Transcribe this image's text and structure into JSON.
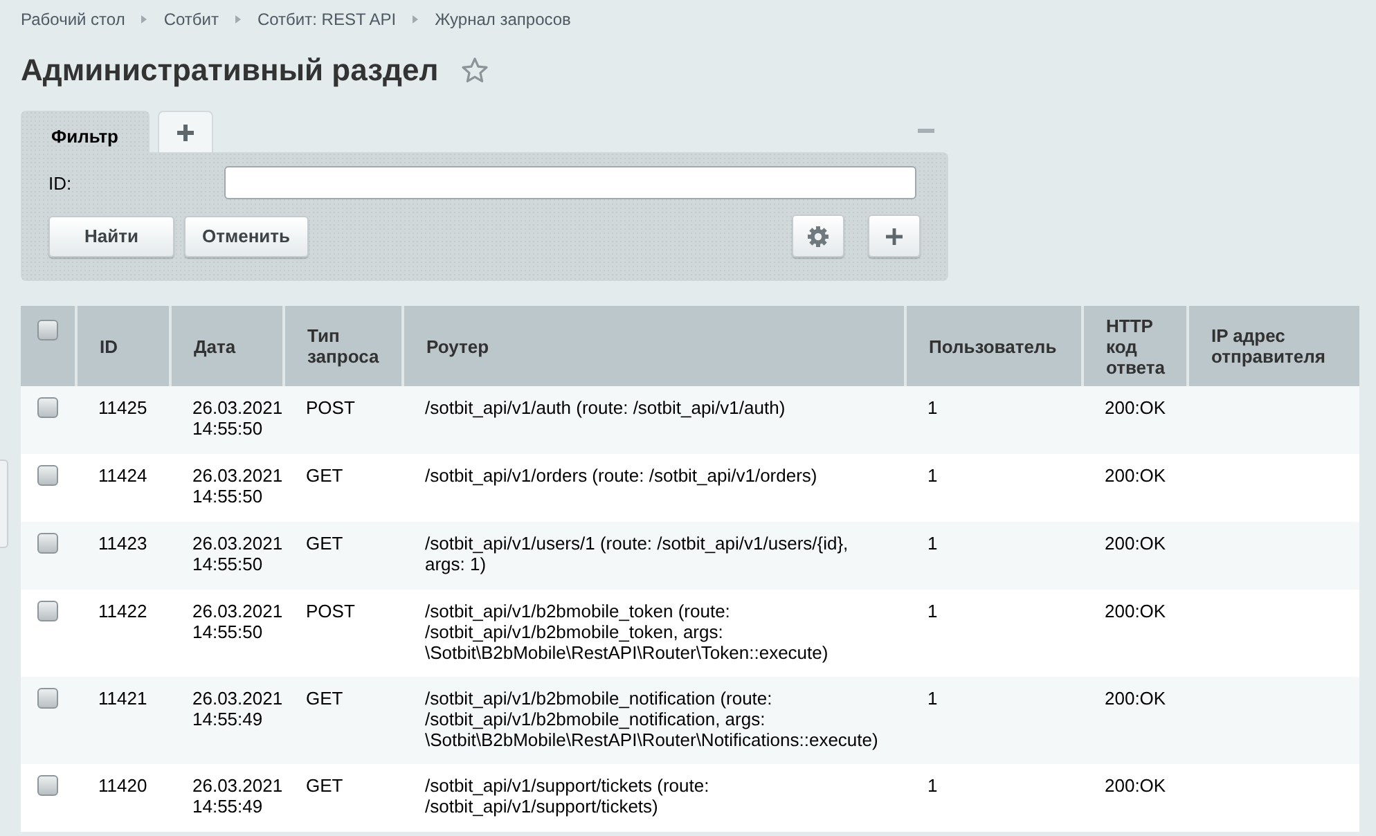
{
  "breadcrumbs": [
    "Рабочий стол",
    "Сотбит",
    "Сотбит: REST API",
    "Журнал запросов"
  ],
  "page_title": "Административный раздел",
  "filter": {
    "tabs": [
      {
        "label": "Фильтр",
        "selected": true
      }
    ],
    "fields": [
      {
        "label": "ID:"
      }
    ],
    "buttons": [
      "Найти",
      "Отменить"
    ]
  },
  "table": {
    "select_all_checked": false,
    "columns": [
      "ID",
      "Дата",
      "Тип запроса",
      "Роутер",
      "Пользователь",
      "HTTP код ответа",
      "IP адрес отправителя"
    ],
    "rows": [
      {
        "checked": false,
        "cells": [
          "11425",
          "26.03.2021 14:55:50",
          "POST",
          "/sotbit_api/v1/auth (route: /sotbit_api/v1/auth)",
          "1",
          "200:OK",
          ""
        ]
      },
      {
        "checked": false,
        "cells": [
          "11424",
          "26.03.2021 14:55:50",
          "GET",
          "/sotbit_api/v1/orders (route: /sotbit_api/v1/orders)",
          "1",
          "200:OK",
          ""
        ]
      },
      {
        "checked": false,
        "cells": [
          "11423",
          "26.03.2021 14:55:50",
          "GET",
          "/sotbit_api/v1/users/1 (route: /sotbit_api/v1/users/{id}, args: 1)",
          "1",
          "200:OK",
          ""
        ]
      },
      {
        "checked": false,
        "cells": [
          "11422",
          "26.03.2021 14:55:50",
          "POST",
          "/sotbit_api/v1/b2bmobile_token (route: /sotbit_api/v1/b2bmobile_token, args: \\Sotbit\\B2bMobile\\RestAPI\\Router\\Token::execute)",
          "1",
          "200:OK",
          ""
        ]
      },
      {
        "checked": false,
        "cells": [
          "11421",
          "26.03.2021 14:55:49",
          "GET",
          "/sotbit_api/v1/b2bmobile_notification (route: /sotbit_api/v1/b2bmobile_notification, args: \\Sotbit\\B2bMobile\\RestAPI\\Router\\Notifications::execute)",
          "1",
          "200:OK",
          ""
        ]
      },
      {
        "checked": false,
        "cells": [
          "11420",
          "26.03.2021 14:55:49",
          "GET",
          "/sotbit_api/v1/support/tickets (route: /sotbit_api/v1/support/tickets)",
          "1",
          "200:OK",
          ""
        ]
      }
    ]
  }
}
